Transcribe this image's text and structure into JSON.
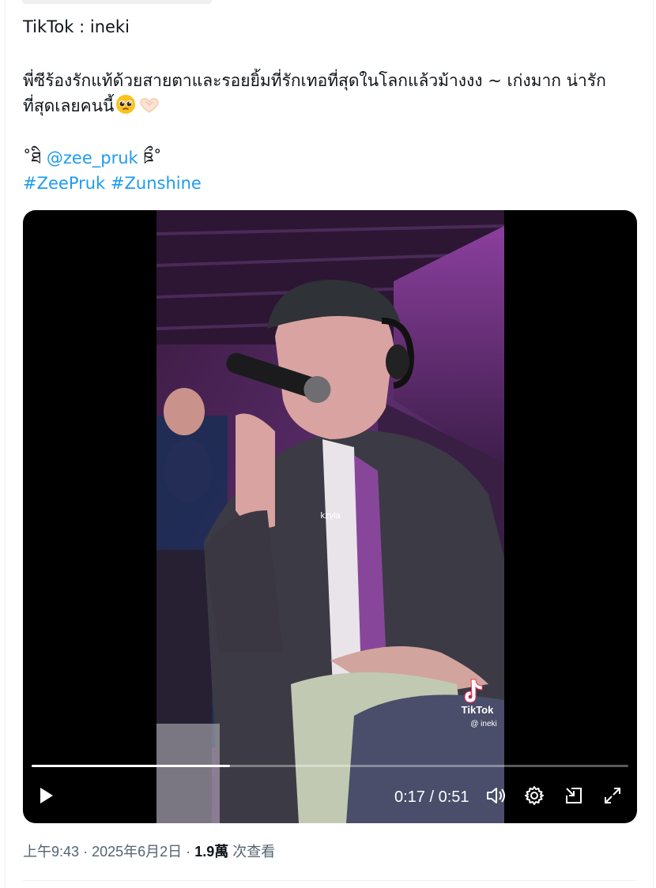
{
  "tweet": {
    "source_line": "TikTok : ineki",
    "body_line1": "พี่ซีร้องรักแท้ด้วยสายตาและรอยยิ้มที่รักเทอที่สุดในโลกแล้วม้างงง ~ เก่งมาก น่ารัก",
    "body_line2": "ที่สุดเลยคนนี้",
    "deco_left": "˚ཐི",
    "mention": "@zee_pruk",
    "deco_right": "ཋྀ˚",
    "hashtag1": "#ZeePruk",
    "hashtag2": "#Zunshine",
    "emoji1": "pleading-face-emoji",
    "emoji2": "heart-hands-emoji"
  },
  "video": {
    "current_time": "0:17",
    "duration": "0:51",
    "time_display": "0:17 / 0:51",
    "progress_fraction": 0.333,
    "overlay_name": "kzyla",
    "watermark_brand": "TikTok",
    "watermark_user": "@ ineki",
    "icons": {
      "play": "play-icon",
      "volume": "volume-icon",
      "settings": "gear-icon",
      "pip": "pip-icon",
      "fullscreen": "fullscreen-icon"
    }
  },
  "meta": {
    "time": "上午9:43",
    "sep1": "·",
    "date": "2025年6月2日",
    "sep2": "·",
    "views_count": "1.9萬",
    "views_label": "次查看"
  },
  "colors": {
    "link": "#1d9bf0",
    "secondary_text": "#536471",
    "primary_text": "#0f1419"
  }
}
